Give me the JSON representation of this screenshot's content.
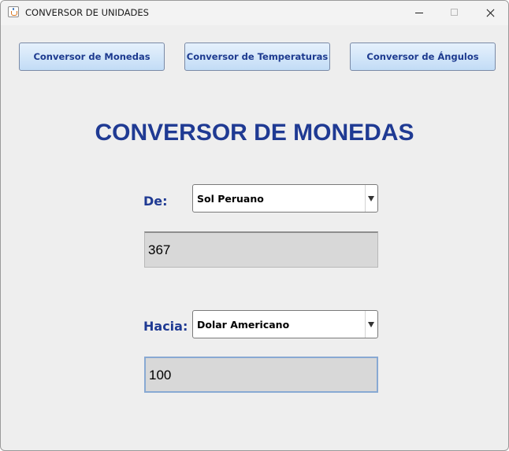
{
  "window": {
    "title": "CONVERSOR DE UNIDADES"
  },
  "nav": {
    "currency_label": "Conversor de Monedas",
    "temperature_label": "Conversor de Temperaturas",
    "angle_label": "Conversor de Ángulos"
  },
  "main": {
    "title": "CONVERSOR DE MONEDAS",
    "from_label": "De:",
    "from_currency": "Sol Peruano",
    "from_amount": "367",
    "to_label": "Hacia:",
    "to_currency": "Dolar Americano",
    "to_amount": "100"
  },
  "icons": {
    "app": "java-cup-icon",
    "minimize": "minimize-icon",
    "maximize": "maximize-icon",
    "close": "close-icon",
    "dropdown": "chevron-down-icon"
  },
  "colors": {
    "accent_text": "#1f3a93",
    "button_bg": "#c2dcf6",
    "window_bg": "#eeeeee",
    "field_bg": "#d8d8d8",
    "focus_border": "#88a9d3"
  }
}
